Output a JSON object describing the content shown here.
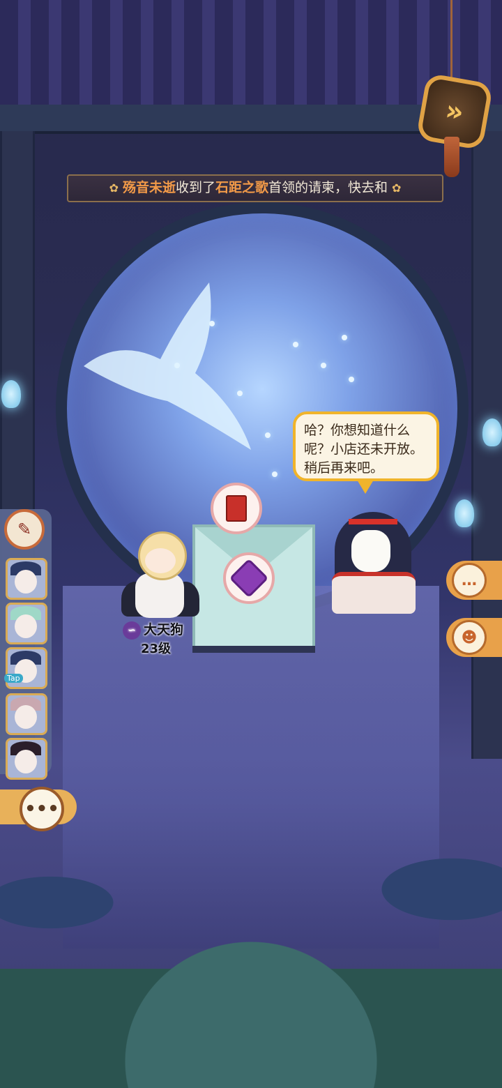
{
  "banner": {
    "sender": "殇音未逝",
    "mid": "收到了",
    "boss": "石距之歌",
    "rest": "首领的请柬，快去和"
  },
  "npc_dialog": "哈？你想知道什么呢？小店还未开放。稍后再来吧。",
  "player": {
    "name": "大天狗",
    "level": "23级"
  },
  "friends": {
    "tap_badge": "Tap"
  },
  "icons": {
    "next": "double-chevron-right-icon",
    "more": "ellipsis-icon",
    "chat": "chat-bubble-icon",
    "emote": "character-emote-icon",
    "book": "red-book-icon",
    "cube": "purple-cube-icon",
    "rank": "purple-rank-icon",
    "flower": "flower-icon"
  },
  "colors": {
    "accent": "#f29a48",
    "frame": "#e0a245"
  }
}
